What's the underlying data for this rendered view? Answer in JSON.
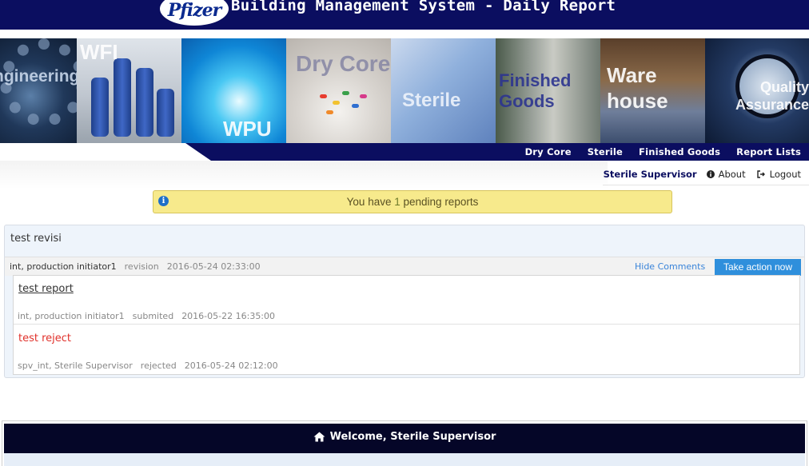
{
  "header": {
    "logo_text": "Pfizer",
    "title": "Building Management System - Daily Report"
  },
  "banner": {
    "tiles": [
      {
        "name": "engineering",
        "overlay": "Engineering"
      },
      {
        "name": "wfi",
        "overlay": "WFI"
      },
      {
        "name": "wpu",
        "overlay": "WPU"
      },
      {
        "name": "dry-core",
        "overlay": "Dry Core"
      },
      {
        "name": "sterile",
        "overlay": "Sterile"
      },
      {
        "name": "finished-goods",
        "overlay": "Finished Goods"
      },
      {
        "name": "warehouse",
        "overlay": "Ware house"
      },
      {
        "name": "quality-assurance",
        "overlay": "Quality Assurance"
      }
    ]
  },
  "nav": {
    "items": [
      "Dry Core",
      "Sterile",
      "Finished Goods",
      "Report Lists"
    ]
  },
  "user": {
    "name": "Sterile Supervisor",
    "about": "About",
    "logout": "Logout"
  },
  "alert": {
    "prefix": "You have",
    "count": "1",
    "suffix": "pending reports"
  },
  "report": {
    "title": "test revisi",
    "author": "int, production initiator1",
    "action": "revision",
    "date": "2016-05-24 02:33:00",
    "hide_comments": "Hide Comments",
    "take_action": "Take action now",
    "comments": [
      {
        "text": "test report",
        "author": "int, production initiator1",
        "action": "submited",
        "date": "2016-05-22 16:35:00"
      },
      {
        "text": "test reject",
        "author": "spv_int, Sterile Supervisor",
        "action": "rejected",
        "date": "2016-05-24 02:12:00"
      }
    ]
  },
  "welcome": {
    "text": "Welcome, Sterile Supervisor"
  },
  "colors": {
    "navy": "#0b0e60",
    "alert_bg": "#f7ea8c",
    "action_blue": "#2f8fdc",
    "reject_red": "#e0302a"
  }
}
